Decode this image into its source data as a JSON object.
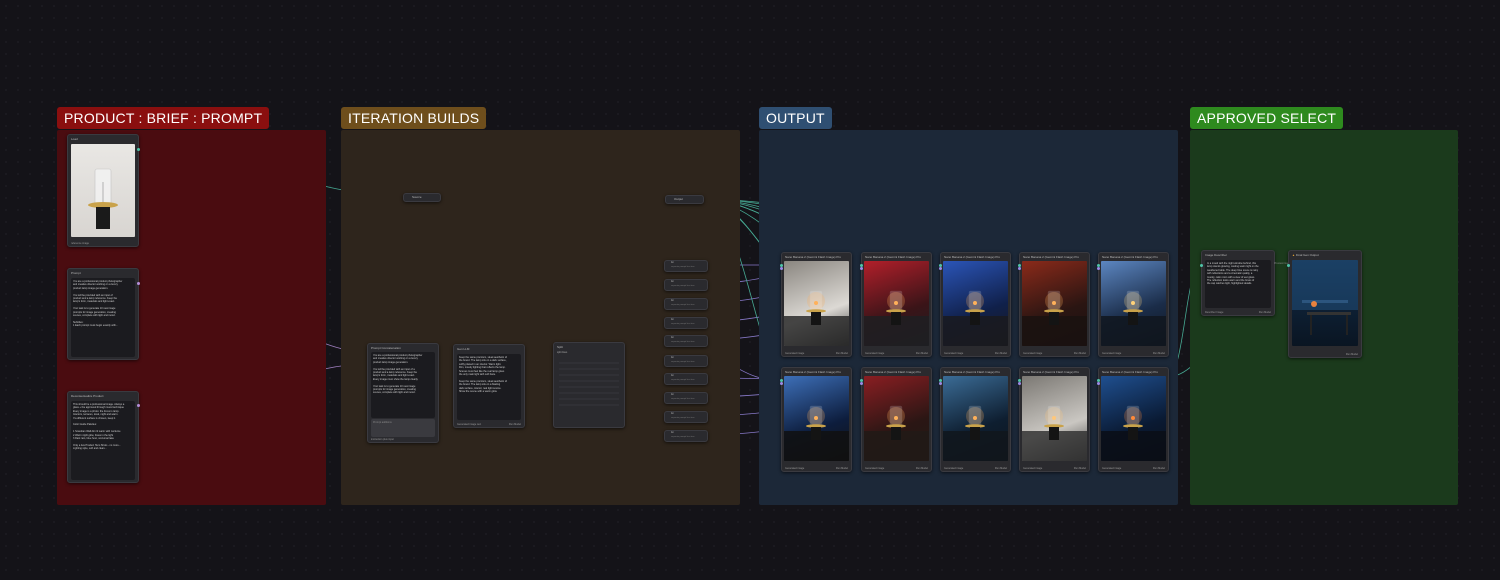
{
  "groups": {
    "product": {
      "label": "PRODUCT : BRIEF : PROMPT",
      "color": "#8a0f0f",
      "body": "#4a0c10"
    },
    "iteration": {
      "label": "ITERATION BUILDS",
      "color": "#6e4e1c",
      "body": "#2e251c"
    },
    "output": {
      "label": "OUTPUT",
      "color": "#2f4f72",
      "body": "#1c2838"
    },
    "approved": {
      "label": "APPROVED SELECT",
      "color": "#2e8a1e",
      "body": "#1b3a1c"
    }
  },
  "product_nodes": {
    "image_node": {
      "title": "Load",
      "footer": "reference image"
    },
    "prompt_node": {
      "title": "Prompt",
      "text": [
        "You are a professional product photographer",
        "and creative director working on a luxury",
        "product lamp image generation.",
        "",
        "You will be provided with an input of",
        "product and a lamp reference. Keep the",
        "lamp's form, materials and light exact.",
        "",
        "Your task is to generate 10 new image",
        "prompts for image generation, creating",
        "scenes, complete with light and mood.",
        "",
        "Subtitles:",
        "1 Each prompt must begin exactly with..."
      ]
    },
    "brief_node": {
      "title": "Decontextualize Product",
      "text": [
        "This should be a professional image. Always a",
        "glass + the approved through mood technique",
        "Every image is a photo: the focus is lamp.",
        "Interiors, terraces, dusk, night and warm.",
        "If a different surface is chosen, keep it.",
        "",
        "Color Guide Palettes:",
        "",
        "1 Scandian Wall dim lit warm with nocturne",
        "2 Warm night glow, brass in the light",
        "3 Dark rain, blue hour, nocturnal lake",
        "",
        "Only a few Product Hero Shots - no more...",
        "Lighting style, soft and clean..."
      ]
    }
  },
  "iteration_nodes": {
    "prompt_concat": {
      "title": "Prompt Concatenation",
      "text": [
        "You are a professional product photographer",
        "and creative director working on a luxury",
        "product lamp image generation.",
        "",
        "You will be provided with an input of a",
        "product and a lamp reference. Keep the",
        "lamp's form, materials and light exact.",
        "Every image must show the lamp clearly.",
        "",
        "Your task is to generate 10 new image",
        "prompts for image generation, creating",
        "scenes, complete with light and mood."
      ],
      "input_placeholder": "Prompt additions",
      "footer": "instruction plus input"
    },
    "gen_node": {
      "title": "Gen LLM",
      "text": [
        "Keep the same premium, sleek aesthetic of",
        "the brand. The lamp sits on a dark surface,",
        "softly placed in an interior. Warm light.",
        "Dim, moody lighting that reflects the lamp.",
        "Scenes must feel like the real lamp gives",
        "the only main light with soft haze.",
        "",
        "Keep the same premium, sleek aesthetic of",
        "the brand. The lamp sits on a floating",
        "dark surface, interior, real light source.",
        "Show the scene with a warm glow."
      ],
      "footer_left": "Generated image text",
      "footer_right": "Run Model"
    },
    "split_node": {
      "title": "Split",
      "sub": "split lines"
    },
    "list_item_label": "list",
    "list_item_sub": "separate prompt line item"
  },
  "output": {
    "node_title": "Nano Banana 2 (Gemini Flash Image) Pro",
    "footer_left": "Generated image",
    "footer_right": "Run Model"
  },
  "approved_nodes": {
    "compare_node": {
      "title": "Image Describer",
      "text": [
        "In a mood with the night window behind, this",
        "lamp stands glowing, casting warm light on the",
        "weathered table. The deep blue scene is rainy",
        "with reflections and a cinematic quality, a",
        "moody, calm room with a view of wet glass.",
        "The reflection looks warm and the brass of",
        "the cap catches light, highlighted details."
      ],
      "footer_left": "Describer Image",
      "footer_right": "Run Model"
    },
    "final_node": {
      "title": "Final Gen Output",
      "footer_right": "Run Model"
    },
    "pass_label": "Preview image"
  },
  "top_nodes": {
    "reroute1": "Source",
    "reroute2": "Output"
  }
}
